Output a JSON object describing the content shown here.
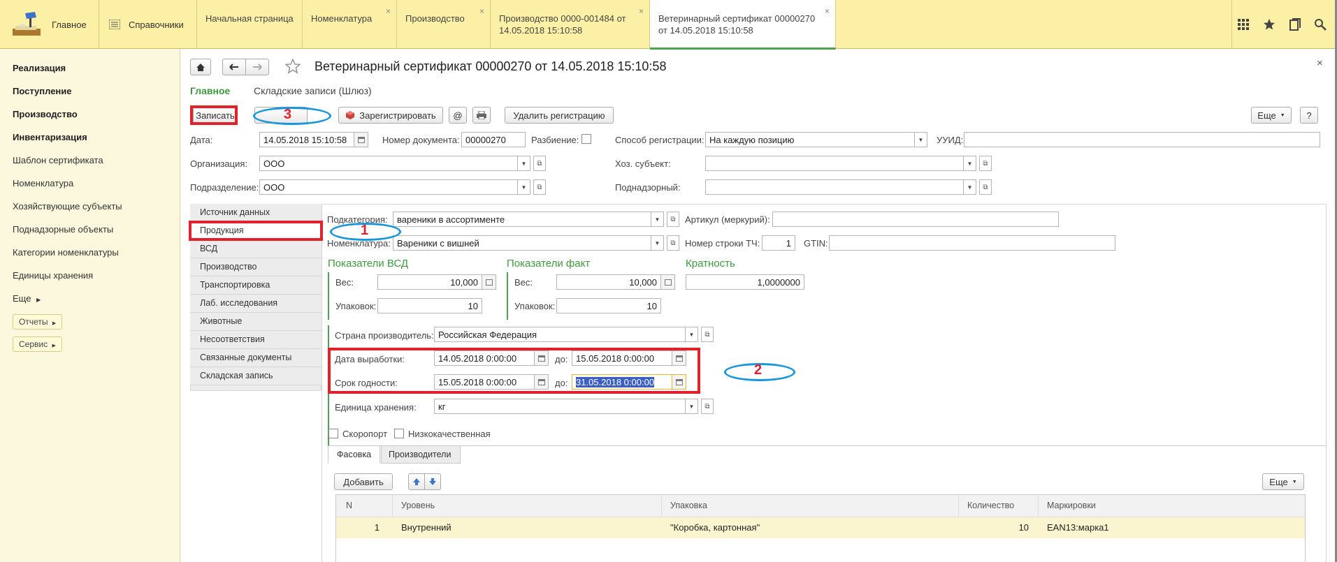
{
  "topbar": {
    "main_label": "Главное",
    "dirs_label": "Справочники",
    "tabs": [
      {
        "line1": "Начальная страница",
        "line2": ""
      },
      {
        "line1": "Номенклатура",
        "line2": ""
      },
      {
        "line1": "Производство",
        "line2": ""
      },
      {
        "line1": "Производство 0000-001484 от",
        "line2": "14.05.2018 15:10:58"
      },
      {
        "line1": "Ветеринарный сертификат 00000270",
        "line2": "от 14.05.2018 15:10:58"
      }
    ],
    "close_glyph": "×"
  },
  "sidebar": {
    "items": [
      "Реализация",
      "Поступление",
      "Производство",
      "Инвентаризация",
      "Шаблон сертификата",
      "Номенклатура",
      "Хозяйствующие субъекты",
      "Поднадзорные объекты",
      "Категории номенклатуры",
      "Единицы хранения",
      "Еще"
    ],
    "reports": "Отчеты",
    "service": "Сервис"
  },
  "form": {
    "title": "Ветеринарный сертификат 00000270 от 14.05.2018 15:10:58",
    "subnav": {
      "main": "Главное",
      "wh": "Складские записи (Шлюз)"
    },
    "toolbar": {
      "save": "Записать",
      "register": "Зарегистрировать",
      "at": "@",
      "delete_reg": "Удалить регистрацию",
      "more": "Еще",
      "help": "?"
    },
    "date_label": "Дата:",
    "date_value": "14.05.2018 15:10:58",
    "docnum_label": "Номер документа:",
    "docnum_value": "00000270",
    "split_label": "Разбиение:",
    "regmode_label": "Способ регистрации:",
    "regmode_value": "На каждую позицию",
    "uuid_label": "УУИД:",
    "org_label": "Организация:",
    "org_value": "ООО",
    "econ_label": "Хоз. субъект:",
    "dept_label": "Подразделение:",
    "dept_value": "ООО",
    "supervised_label": "Поднадзорный:"
  },
  "nav": [
    "Источник данных",
    "Продукция",
    "ВСД",
    "Производство",
    "Транспортировка",
    "Лаб. исследования",
    "Животные",
    "Несоответствия",
    "Связанные документы",
    "Складская запись"
  ],
  "product": {
    "subcat_label": "Подкатегория:",
    "subcat_value": "вареники в ассортименте",
    "article_label": "Артикул (меркурий):",
    "nomen_label": "Номенклатура:",
    "nomen_value": "Вареники с вишней",
    "rownum_label": "Номер строки ТЧ:",
    "rownum_value": "1",
    "gtin_label": "GTIN:",
    "vsd_header": "Показатели ВСД",
    "fact_header": "Показатели факт",
    "mult_header": "Кратность",
    "weight_label": "Вес:",
    "pack_label": "Упаковок:",
    "vsd_weight": "10,000",
    "vsd_packs": "10",
    "fact_weight": "10,000",
    "fact_packs": "10",
    "mult_value": "1,0000000",
    "country_label": "Страна производитель:",
    "country_value": "Российская Федерация",
    "prod_date_label": "Дата выработки:",
    "prod_date_from": "14.05.2018  0:00:00",
    "to_label": "до:",
    "prod_date_to": "15.05.2018  0:00:00",
    "expiry_label": "Срок годности:",
    "expiry_from": "15.05.2018  0:00:00",
    "expiry_to": "31.05.2018  0:00:00",
    "unit_label": "Единица хранения:",
    "unit_value": "кг",
    "perishable_label": "Скоропорт",
    "lowquality_label": "Низкокачественная"
  },
  "inner_tabs": [
    "Фасовка",
    "Производители"
  ],
  "table_toolbar": {
    "add": "Добавить",
    "more": "Еще"
  },
  "table": {
    "headers": [
      "N",
      "Уровень",
      "Упаковка",
      "Количество",
      "Маркировки"
    ],
    "rows": [
      {
        "n": "1",
        "level": "Внутренний",
        "pack": "\"Коробка, картонная\"",
        "qty": "10",
        "marks": "EAN13:марка1"
      }
    ]
  },
  "annotations": {
    "n1": "1",
    "n2": "2",
    "n3": "3"
  },
  "colors": {
    "topbar_bg": "#fbf0a6",
    "sidebar_bg": "#fbf8dd",
    "accent_green": "#3e9a3e",
    "annotation_red": "#e1212c",
    "annotation_blue": "#1997d8",
    "selection_blue": "#3d5fc4",
    "row_highlight": "#fbf5cf"
  }
}
